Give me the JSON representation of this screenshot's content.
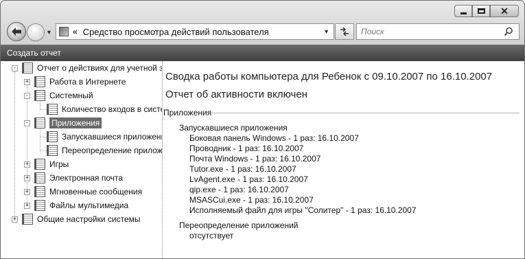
{
  "window": {
    "address_text": "Средство просмотра действий пользователя",
    "address_chevron": "«",
    "search_placeholder": "Поиск",
    "title_bar": "Создать отчет"
  },
  "tree": [
    {
      "label": "Отчет о действиях для учетной записи",
      "expander": "-",
      "level": 0
    },
    {
      "label": "Работа в Интернете",
      "expander": "+",
      "level": 1
    },
    {
      "label": "Системный",
      "expander": "-",
      "level": 1
    },
    {
      "label": "Количество входов в систему",
      "expander": "",
      "level": 2
    },
    {
      "label": "Приложения",
      "expander": "-",
      "level": 1,
      "selected": true
    },
    {
      "label": "Запускавшиеся приложения",
      "expander": "",
      "level": 2
    },
    {
      "label": "Переопределение приложений",
      "expander": "",
      "level": 2
    },
    {
      "label": "Игры",
      "expander": "+",
      "level": 1
    },
    {
      "label": "Электронная почта",
      "expander": "+",
      "level": 1
    },
    {
      "label": "Мгновенные сообщения",
      "expander": "+",
      "level": 1
    },
    {
      "label": "Файлы мультимедиа",
      "expander": "+",
      "level": 1
    },
    {
      "label": "Общие настройки системы",
      "expander": "+",
      "level": 0
    }
  ],
  "report": {
    "heading": "Сводка работы компьютера для Ребенок с 09.10.2007 по 16.10.2007",
    "status": "Отчет об активности включен",
    "section_title": "Приложения",
    "launched_title": "Запускавшиеся приложения",
    "launched_items": [
      "Боковая панель Windows - 1 раз: 16.10.2007",
      "Проводник - 1 раз: 16.10.2007",
      "Почта Windows - 1 раз: 16.10.2007",
      "Tutor.exe - 1 раз: 16.10.2007",
      "LvAgent.exe - 1 раз: 16.10.2007",
      "qip.exe - 1 раз: 16.10.2007",
      "MSASCui.exe - 1 раз: 16.10.2007",
      "Исполняемый файл для игры \"Солитер\" - 1 раз: 16.10.2007"
    ],
    "override_title": "Переопределение приложений",
    "override_value": "отсутствует"
  }
}
